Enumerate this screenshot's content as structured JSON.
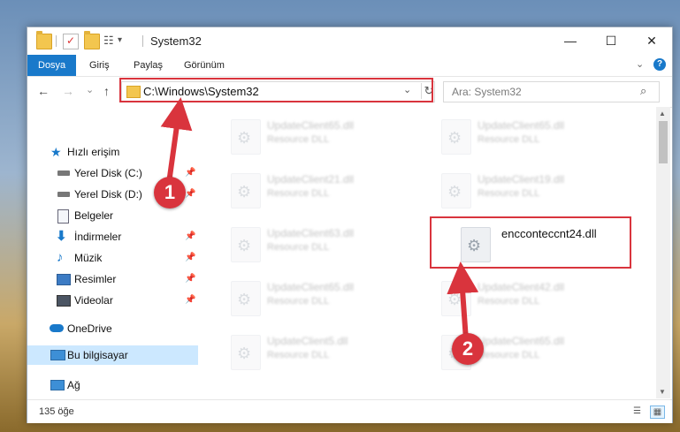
{
  "window": {
    "title": "System32",
    "minimize": "—",
    "maximize": "☐",
    "close": "✕"
  },
  "quick_access_toolbar": {
    "dropdown": "▾",
    "view_icon": "☷"
  },
  "ribbon": {
    "tabs": [
      {
        "label": "Dosya",
        "active": true
      },
      {
        "label": "Giriş"
      },
      {
        "label": "Paylaş"
      },
      {
        "label": "Görünüm"
      }
    ],
    "help": "?",
    "collapse": "⌄"
  },
  "navigation": {
    "back": "←",
    "forward": "→",
    "recent": "⌄",
    "up": "↑",
    "address": "C:\\Windows\\System32",
    "address_dropdown": "⌄",
    "refresh": "↻",
    "search_placeholder": "Ara: System32",
    "search_icon": "⌕"
  },
  "sidebar": {
    "pin_glyph": "📌",
    "items": [
      {
        "label": "Hızlı erişim",
        "icon": "star-icon"
      },
      {
        "label": "Yerel Disk (C:)",
        "icon": "drive-icon",
        "pinned": true
      },
      {
        "label": "Yerel Disk (D:)",
        "icon": "drive-icon",
        "pinned": true
      },
      {
        "label": "Belgeler",
        "icon": "document-icon",
        "pinned": true
      },
      {
        "label": "İndirmeler",
        "icon": "download-icon",
        "pinned": true
      },
      {
        "label": "Müzik",
        "icon": "music-icon",
        "pinned": true
      },
      {
        "label": "Resimler",
        "icon": "pictures-icon",
        "pinned": true
      },
      {
        "label": "Videolar",
        "icon": "video-icon",
        "pinned": true
      },
      {
        "label": "OneDrive",
        "icon": "cloud-icon"
      },
      {
        "label": "Bu bilgisayar",
        "icon": "computer-icon",
        "selected": true
      },
      {
        "label": "Ağ",
        "icon": "network-icon"
      }
    ]
  },
  "files": [
    {
      "name": "UpdateClient65.dll",
      "desc": "Resource DLL",
      "blurred": true
    },
    {
      "name": "UpdateClient65.dll",
      "desc": "Resource DLL",
      "blurred": true
    },
    {
      "name": "UpdateClient21.dll",
      "desc": "Resource DLL",
      "blurred": true
    },
    {
      "name": "UpdateClient19.dll",
      "desc": "Resource DLL",
      "blurred": true
    },
    {
      "name": "UpdateClient63.dll",
      "desc": "Resource DLL",
      "blurred": true
    },
    {
      "name": "encconteccnt24.dll",
      "desc": "",
      "blurred": false
    },
    {
      "name": "UpdateClient65.dll",
      "desc": "Resource DLL",
      "blurred": true
    },
    {
      "name": "UpdateClient42.dll",
      "desc": "Resource DLL",
      "blurred": true
    },
    {
      "name": "UpdateClient5.dll",
      "desc": "Resource DLL",
      "blurred": true
    },
    {
      "name": "UpdateClient65.dll",
      "desc": "Resource DLL",
      "blurred": true
    }
  ],
  "status": {
    "count": "135 öğe"
  },
  "view_buttons": {
    "details": "☰",
    "tiles": "▦"
  },
  "scrollbar": {
    "up": "▲",
    "down": "▼"
  },
  "callouts": {
    "one": "1",
    "two": "2"
  },
  "colors": {
    "accent": "#1979ca",
    "callout": "#d9343d",
    "selected": "#cce8ff"
  }
}
